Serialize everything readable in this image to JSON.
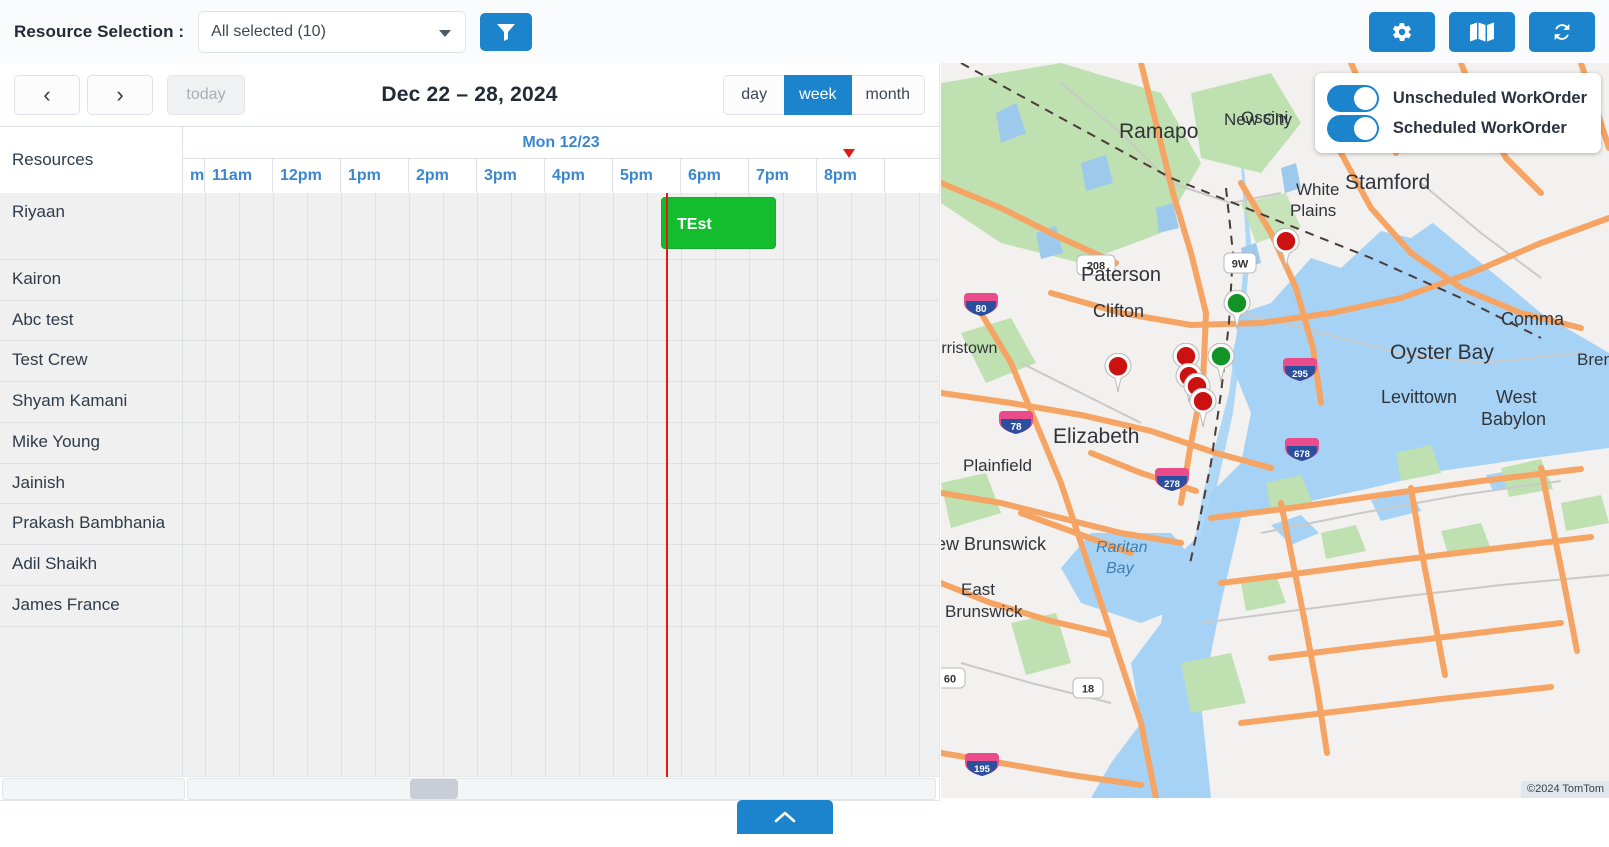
{
  "topbar": {
    "resource_label": "Resource Selection :",
    "select_value": "All selected (10)",
    "filter_icon": "filter-funnel-icon",
    "settings_icon": "gear-icon",
    "map_icon": "map-icon",
    "refresh_icon": "refresh-sync-icon",
    "accent_color": "#1b84cd"
  },
  "calendar": {
    "prev_label": "‹",
    "next_label": "›",
    "today_label": "today",
    "title": "Dec 22 – 28, 2024",
    "views": [
      {
        "label": "day",
        "active": false
      },
      {
        "label": "week",
        "active": true
      },
      {
        "label": "month",
        "active": false
      }
    ],
    "resources_header": "Resources",
    "day_label": "Mon 12/23",
    "hours": [
      "m",
      "11am",
      "12pm",
      "1pm",
      "2pm",
      "3pm",
      "4pm",
      "5pm",
      "6pm",
      "7pm",
      "8pm"
    ],
    "resources": [
      "Riyaan",
      "Kairon",
      "Abc test",
      "Test Crew",
      "Shyam Kamani",
      "Mike Young",
      "Jainish",
      "Prakash Bambhania",
      "Adil Shaikh",
      "James France"
    ],
    "events": [
      {
        "title": "TEst",
        "resource": "Riyaan",
        "color": "#14bd2e"
      }
    ],
    "now_indicator_color": "#e01b1b",
    "collapse_icon": "chevron-up-icon"
  },
  "map": {
    "toggles": [
      {
        "label": "Unscheduled WorkOrder",
        "on": true
      },
      {
        "label": "Scheduled WorkOrder",
        "on": true
      }
    ],
    "attribution": "©2024 TomTom",
    "marker_colors": {
      "unscheduled": "#cc1111",
      "scheduled": "#119326"
    },
    "labels": [
      "Ramapo",
      "New City",
      "Ossini",
      "White Plains",
      "Stamford",
      "Paterson",
      "Clifton",
      "Oyster Bay",
      "Comma",
      "Bren",
      "rristown",
      "Levittown",
      "West Babylon",
      "Elizabeth",
      "Plainfield",
      "ew Brunswick",
      "Raritan Bay",
      "East Brunswick"
    ],
    "shields": [
      "208",
      "9W",
      "80",
      "295",
      "78",
      "678",
      "278",
      "18",
      "60",
      "195"
    ]
  }
}
